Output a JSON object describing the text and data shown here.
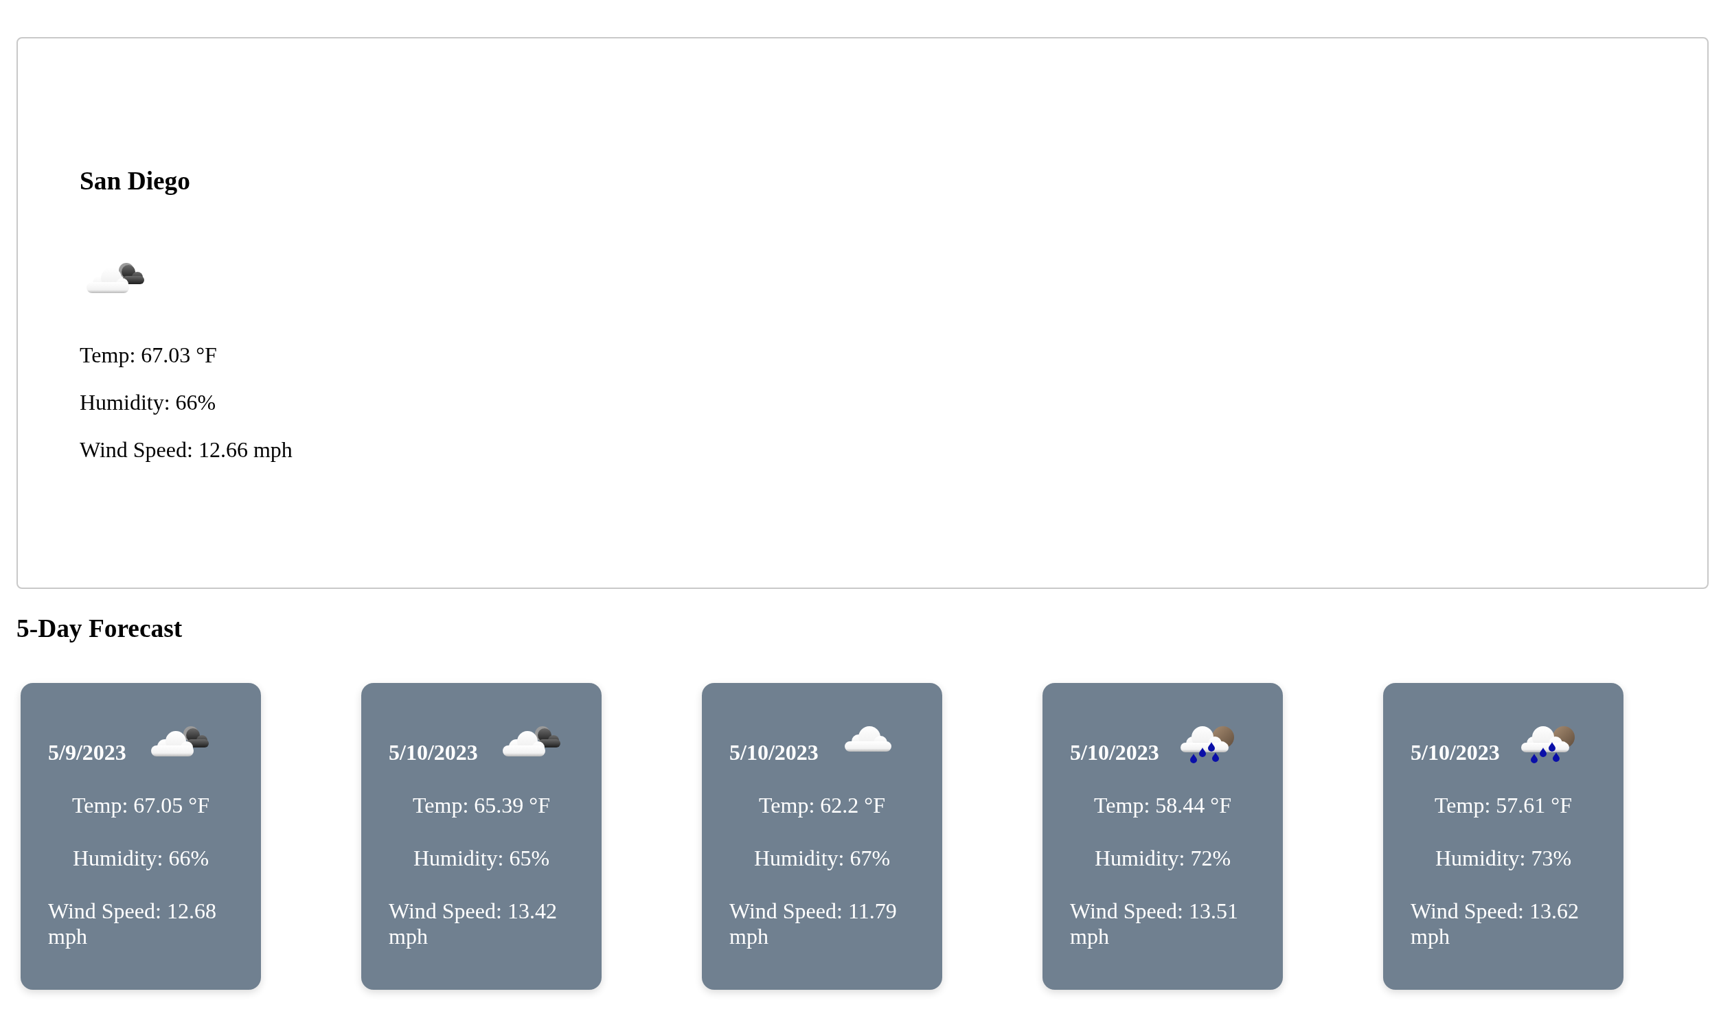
{
  "current": {
    "city": "San Diego",
    "kind": "broken",
    "temp": "Temp: 67.03 °F",
    "humidity": "Humidity: 66%",
    "wind": "Wind Speed: 12.66 mph"
  },
  "forecast": {
    "title": "5-Day Forecast",
    "days": [
      {
        "date": "5/9/2023",
        "kind": "broken",
        "temp": "Temp: 67.05 °F",
        "humidity": "Humidity: 66%",
        "wind": "Wind Speed: 12.68 mph"
      },
      {
        "date": "5/10/2023",
        "kind": "broken",
        "temp": "Temp: 65.39 °F",
        "humidity": "Humidity: 65%",
        "wind": "Wind Speed: 13.42 mph"
      },
      {
        "date": "5/10/2023",
        "kind": "scattered",
        "temp": "Temp: 62.2 °F",
        "humidity": "Humidity: 67%",
        "wind": "Wind Speed: 11.79 mph"
      },
      {
        "date": "5/10/2023",
        "kind": "rain",
        "temp": "Temp: 58.44 °F",
        "humidity": "Humidity: 72%",
        "wind": "Wind Speed: 13.51 mph"
      },
      {
        "date": "5/10/2023",
        "kind": "rain",
        "temp": "Temp: 57.61 °F",
        "humidity": "Humidity: 73%",
        "wind": "Wind Speed: 13.62 mph"
      }
    ]
  }
}
